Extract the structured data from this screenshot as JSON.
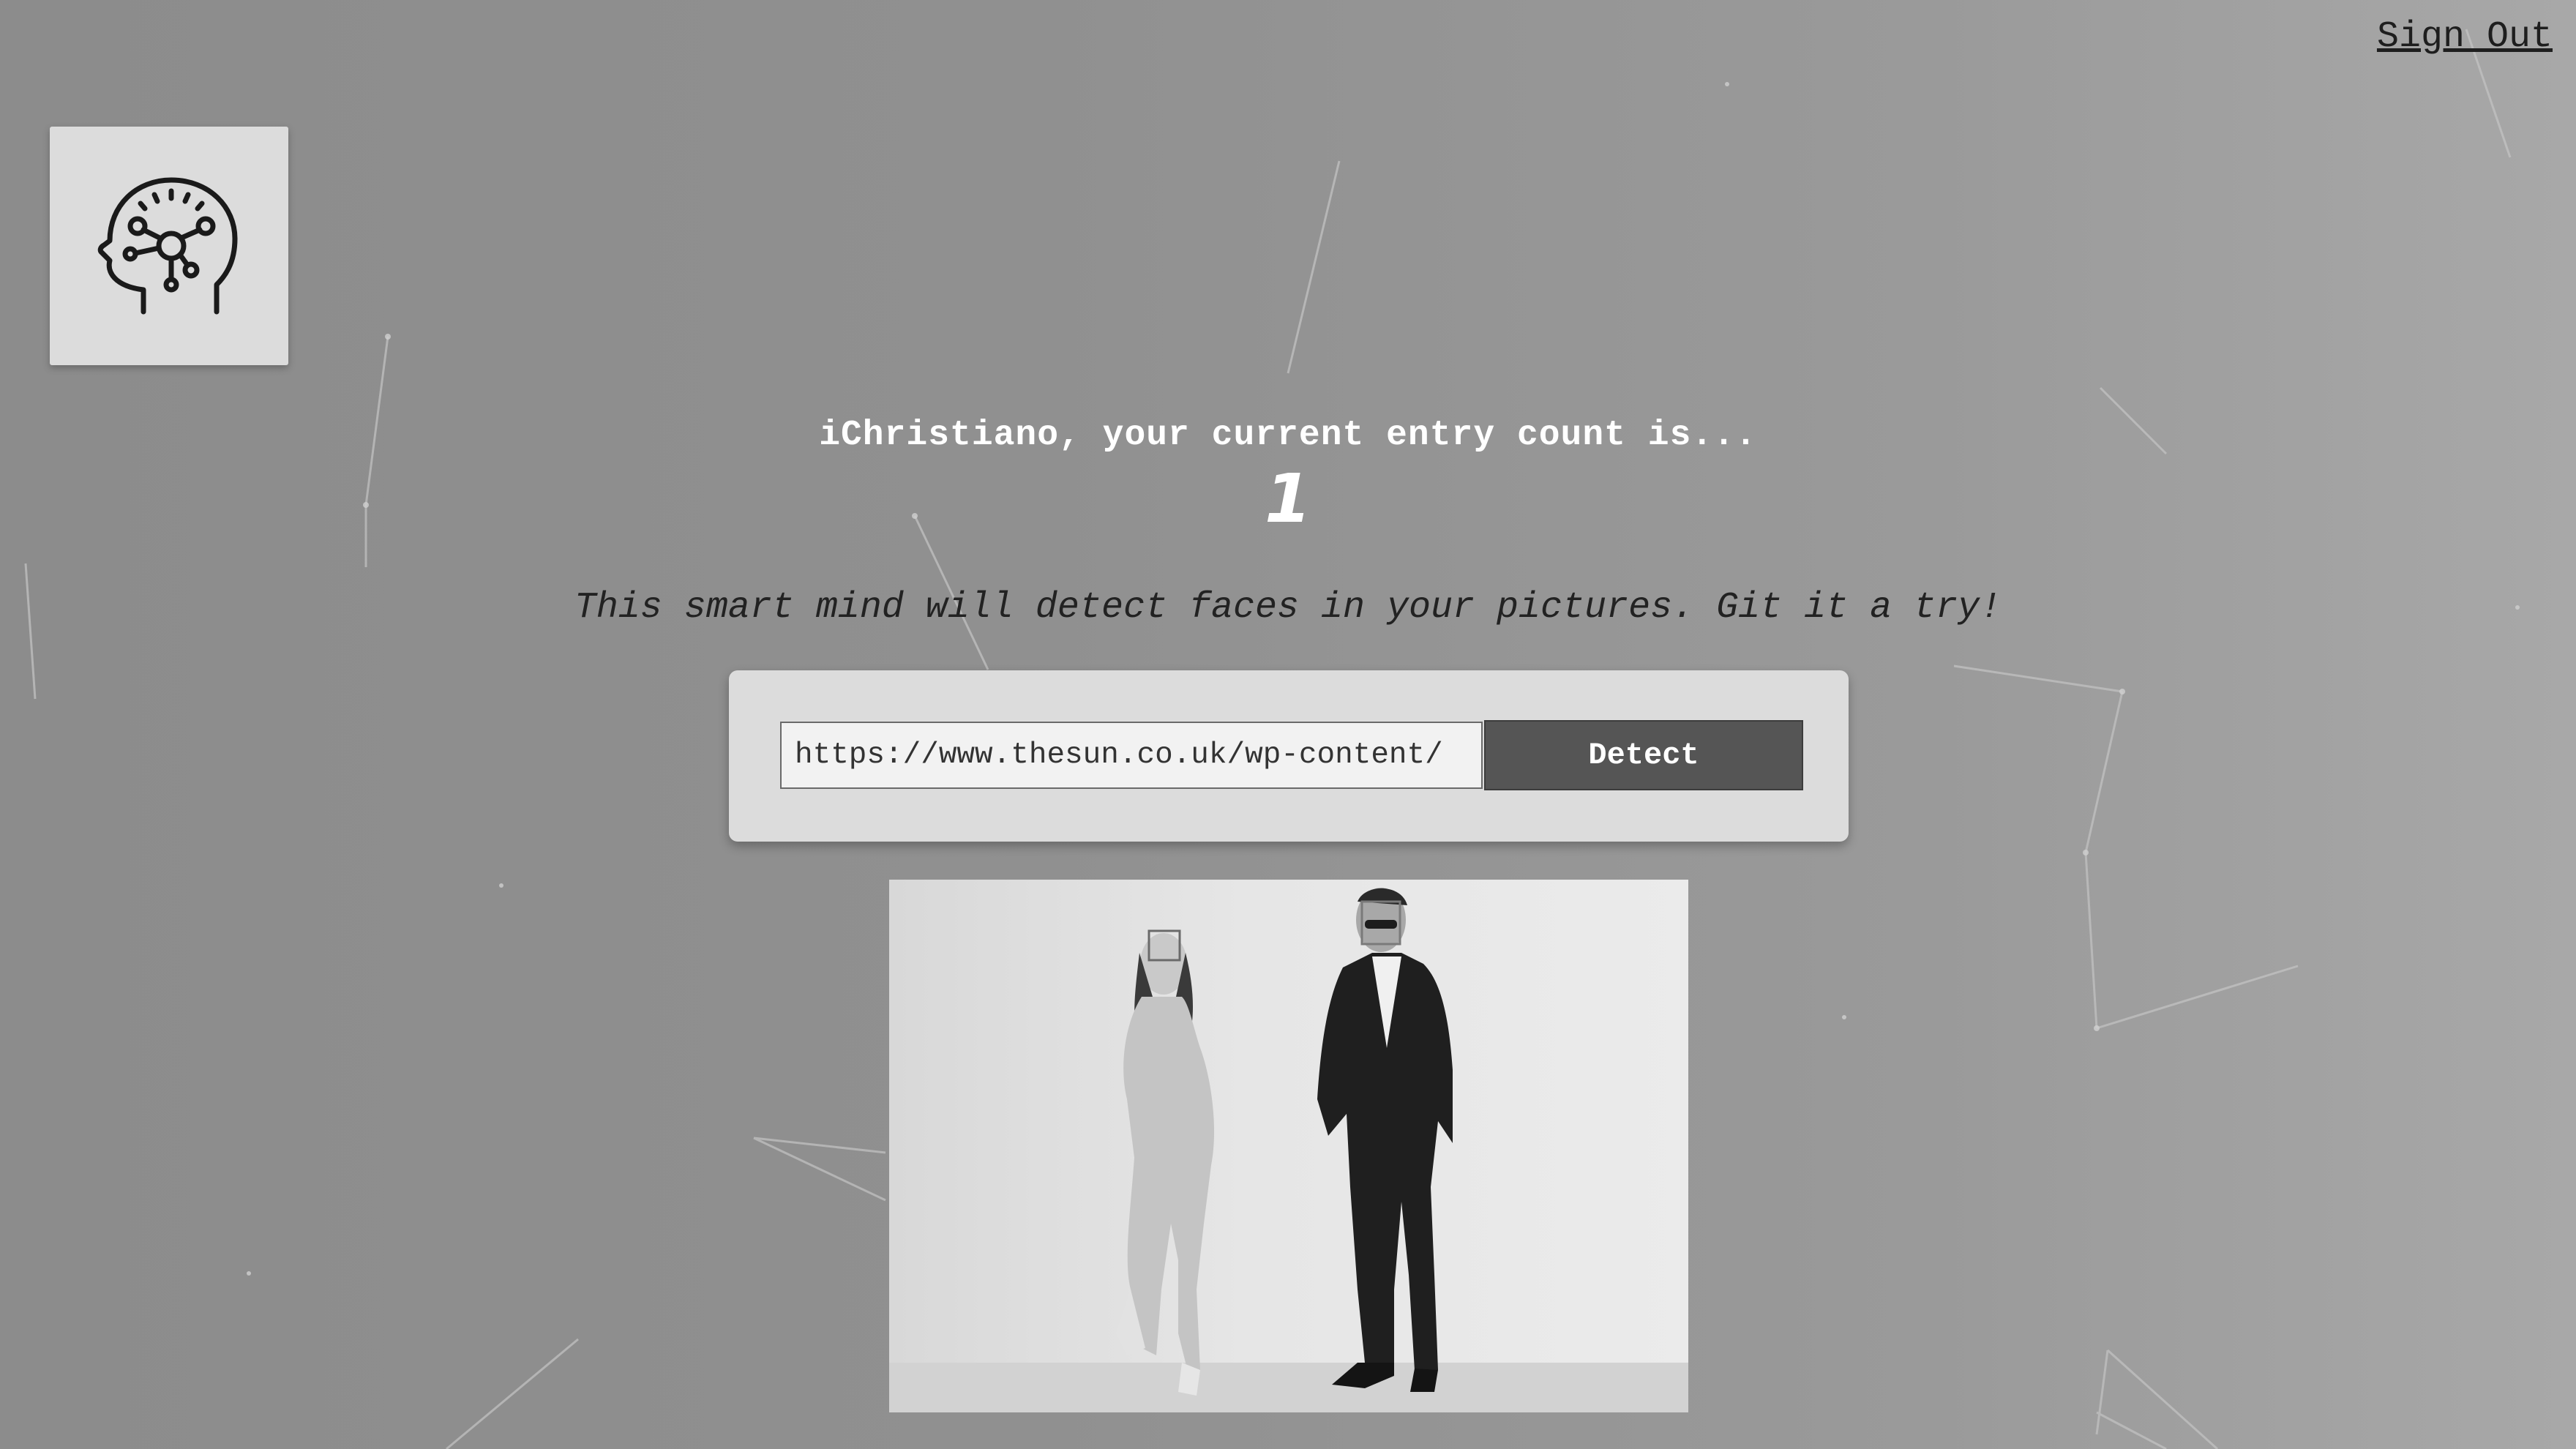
{
  "header": {
    "sign_out_label": "Sign Out"
  },
  "logo": {
    "icon": "brain-network-head-icon"
  },
  "greeting": {
    "text": "iChristiano, your current entry count is...",
    "count": "1"
  },
  "tagline": "This smart mind will detect faces in your pictures. Git it a try!",
  "form": {
    "url_value": "https://www.thesun.co.uk/wp-content/",
    "button_label": "Detect"
  },
  "result_image": {
    "description_icon": "photo-two-people-with-face-boxes",
    "face_boxes": 2
  },
  "colors": {
    "background": "#909090",
    "card": "#dcdcdc",
    "button": "#555555",
    "text_light": "#ffffff",
    "text_dark": "#222222"
  }
}
